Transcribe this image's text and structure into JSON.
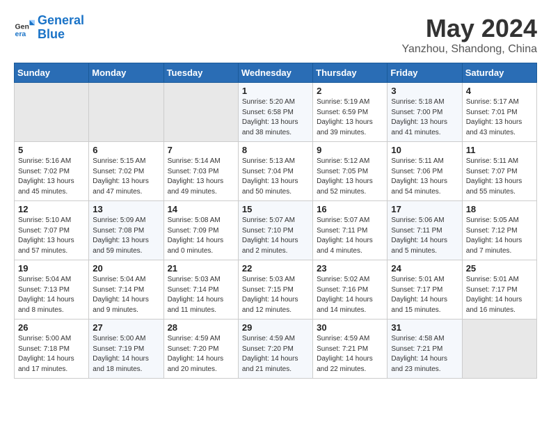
{
  "header": {
    "logo_line1": "General",
    "logo_line2": "Blue",
    "month": "May 2024",
    "location": "Yanzhou, Shandong, China"
  },
  "weekdays": [
    "Sunday",
    "Monday",
    "Tuesday",
    "Wednesday",
    "Thursday",
    "Friday",
    "Saturday"
  ],
  "weeks": [
    [
      {
        "day": "",
        "info": ""
      },
      {
        "day": "",
        "info": ""
      },
      {
        "day": "",
        "info": ""
      },
      {
        "day": "1",
        "info": "Sunrise: 5:20 AM\nSunset: 6:58 PM\nDaylight: 13 hours\nand 38 minutes."
      },
      {
        "day": "2",
        "info": "Sunrise: 5:19 AM\nSunset: 6:59 PM\nDaylight: 13 hours\nand 39 minutes."
      },
      {
        "day": "3",
        "info": "Sunrise: 5:18 AM\nSunset: 7:00 PM\nDaylight: 13 hours\nand 41 minutes."
      },
      {
        "day": "4",
        "info": "Sunrise: 5:17 AM\nSunset: 7:01 PM\nDaylight: 13 hours\nand 43 minutes."
      }
    ],
    [
      {
        "day": "5",
        "info": "Sunrise: 5:16 AM\nSunset: 7:02 PM\nDaylight: 13 hours\nand 45 minutes."
      },
      {
        "day": "6",
        "info": "Sunrise: 5:15 AM\nSunset: 7:02 PM\nDaylight: 13 hours\nand 47 minutes."
      },
      {
        "day": "7",
        "info": "Sunrise: 5:14 AM\nSunset: 7:03 PM\nDaylight: 13 hours\nand 49 minutes."
      },
      {
        "day": "8",
        "info": "Sunrise: 5:13 AM\nSunset: 7:04 PM\nDaylight: 13 hours\nand 50 minutes."
      },
      {
        "day": "9",
        "info": "Sunrise: 5:12 AM\nSunset: 7:05 PM\nDaylight: 13 hours\nand 52 minutes."
      },
      {
        "day": "10",
        "info": "Sunrise: 5:11 AM\nSunset: 7:06 PM\nDaylight: 13 hours\nand 54 minutes."
      },
      {
        "day": "11",
        "info": "Sunrise: 5:11 AM\nSunset: 7:07 PM\nDaylight: 13 hours\nand 55 minutes."
      }
    ],
    [
      {
        "day": "12",
        "info": "Sunrise: 5:10 AM\nSunset: 7:07 PM\nDaylight: 13 hours\nand 57 minutes."
      },
      {
        "day": "13",
        "info": "Sunrise: 5:09 AM\nSunset: 7:08 PM\nDaylight: 13 hours\nand 59 minutes."
      },
      {
        "day": "14",
        "info": "Sunrise: 5:08 AM\nSunset: 7:09 PM\nDaylight: 14 hours\nand 0 minutes."
      },
      {
        "day": "15",
        "info": "Sunrise: 5:07 AM\nSunset: 7:10 PM\nDaylight: 14 hours\nand 2 minutes."
      },
      {
        "day": "16",
        "info": "Sunrise: 5:07 AM\nSunset: 7:11 PM\nDaylight: 14 hours\nand 4 minutes."
      },
      {
        "day": "17",
        "info": "Sunrise: 5:06 AM\nSunset: 7:11 PM\nDaylight: 14 hours\nand 5 minutes."
      },
      {
        "day": "18",
        "info": "Sunrise: 5:05 AM\nSunset: 7:12 PM\nDaylight: 14 hours\nand 7 minutes."
      }
    ],
    [
      {
        "day": "19",
        "info": "Sunrise: 5:04 AM\nSunset: 7:13 PM\nDaylight: 14 hours\nand 8 minutes."
      },
      {
        "day": "20",
        "info": "Sunrise: 5:04 AM\nSunset: 7:14 PM\nDaylight: 14 hours\nand 9 minutes."
      },
      {
        "day": "21",
        "info": "Sunrise: 5:03 AM\nSunset: 7:14 PM\nDaylight: 14 hours\nand 11 minutes."
      },
      {
        "day": "22",
        "info": "Sunrise: 5:03 AM\nSunset: 7:15 PM\nDaylight: 14 hours\nand 12 minutes."
      },
      {
        "day": "23",
        "info": "Sunrise: 5:02 AM\nSunset: 7:16 PM\nDaylight: 14 hours\nand 14 minutes."
      },
      {
        "day": "24",
        "info": "Sunrise: 5:01 AM\nSunset: 7:17 PM\nDaylight: 14 hours\nand 15 minutes."
      },
      {
        "day": "25",
        "info": "Sunrise: 5:01 AM\nSunset: 7:17 PM\nDaylight: 14 hours\nand 16 minutes."
      }
    ],
    [
      {
        "day": "26",
        "info": "Sunrise: 5:00 AM\nSunset: 7:18 PM\nDaylight: 14 hours\nand 17 minutes."
      },
      {
        "day": "27",
        "info": "Sunrise: 5:00 AM\nSunset: 7:19 PM\nDaylight: 14 hours\nand 18 minutes."
      },
      {
        "day": "28",
        "info": "Sunrise: 4:59 AM\nSunset: 7:20 PM\nDaylight: 14 hours\nand 20 minutes."
      },
      {
        "day": "29",
        "info": "Sunrise: 4:59 AM\nSunset: 7:20 PM\nDaylight: 14 hours\nand 21 minutes."
      },
      {
        "day": "30",
        "info": "Sunrise: 4:59 AM\nSunset: 7:21 PM\nDaylight: 14 hours\nand 22 minutes."
      },
      {
        "day": "31",
        "info": "Sunrise: 4:58 AM\nSunset: 7:21 PM\nDaylight: 14 hours\nand 23 minutes."
      },
      {
        "day": "",
        "info": ""
      }
    ]
  ]
}
